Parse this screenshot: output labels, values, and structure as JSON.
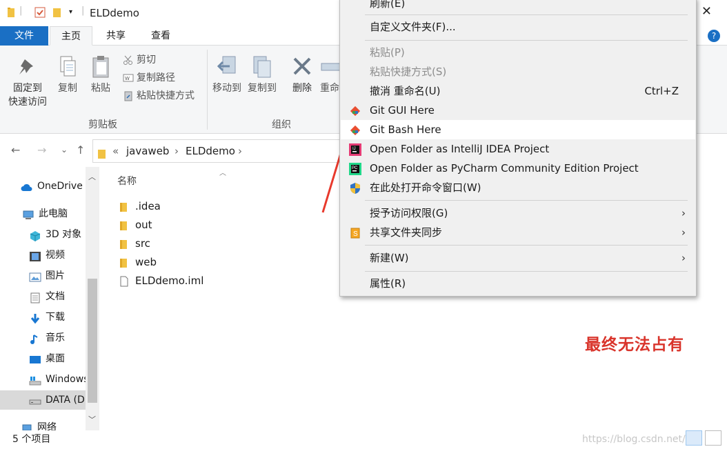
{
  "window": {
    "title": "ELDdemo",
    "close_glyph": "✕"
  },
  "ribbon_tabs": [
    "文件",
    "主页",
    "共享",
    "查看"
  ],
  "help_glyph": "?",
  "ribbon": {
    "pin": {
      "line1": "固定到",
      "line2": "快速访问"
    },
    "copy": "复制",
    "paste": "粘贴",
    "cut": "剪切",
    "copy_path": "复制路径",
    "paste_shortcut": "粘贴快捷方式",
    "clipboard_group": "剪贴板",
    "move_to": "移动到",
    "copy_to": "复制到",
    "delete": "删除",
    "rename": "重命",
    "organize_group": "组织"
  },
  "address": {
    "overflow": "«",
    "crumbs": [
      "javaweb",
      "ELDdemo"
    ],
    "sep": "›"
  },
  "nav_pane": {
    "items": [
      {
        "label": "OneDrive",
        "icon": "cloud-icon"
      },
      {
        "label": "此电脑",
        "icon": "computer-icon"
      },
      {
        "label": "3D 对象",
        "icon": "cube-icon"
      },
      {
        "label": "视频",
        "icon": "video-icon"
      },
      {
        "label": "图片",
        "icon": "picture-icon"
      },
      {
        "label": "文档",
        "icon": "document-icon"
      },
      {
        "label": "下载",
        "icon": "download-icon"
      },
      {
        "label": "音乐",
        "icon": "music-icon"
      },
      {
        "label": "桌面",
        "icon": "desktop-icon"
      },
      {
        "label": "Windows",
        "icon": "drive-icon"
      },
      {
        "label": "DATA (D:)",
        "icon": "drive-icon"
      },
      {
        "label": "网络",
        "icon": "network-icon"
      }
    ]
  },
  "file_list": {
    "column_name": "名称",
    "files": [
      {
        "name": ".idea",
        "type": "folder"
      },
      {
        "name": "out",
        "type": "folder"
      },
      {
        "name": "src",
        "type": "folder"
      },
      {
        "name": "web",
        "type": "folder"
      },
      {
        "name": "ELDdemo.iml",
        "type": "file"
      }
    ]
  },
  "status": {
    "item_count": "5 个项目",
    "watermark": "https://blog.csdn.net/"
  },
  "annotation": "最终无法占有",
  "context_menu": {
    "refresh": "刷新(E)",
    "customize": "自定义文件夹(F)...",
    "paste": "粘贴(P)",
    "paste_shortcut": "粘贴快捷方式(S)",
    "undo": "撤消 重命名(U)",
    "undo_shortcut": "Ctrl+Z",
    "git_gui": "Git GUI Here",
    "git_bash": "Git Bash Here",
    "intellij": "Open Folder as IntelliJ IDEA Project",
    "pycharm": "Open Folder as PyCharm Community Edition Project",
    "cmd": "在此处打开命令窗口(W)",
    "grant_access": "授予访问权限(G)",
    "share_sync": "共享文件夹同步",
    "new": "新建(W)",
    "properties": "属性(R)",
    "submenu_glyph": "›"
  },
  "colors": {
    "accent_blue": "#1a6fc4",
    "annotation_red": "#d9342b",
    "folder_yellow": "#f1c243"
  }
}
